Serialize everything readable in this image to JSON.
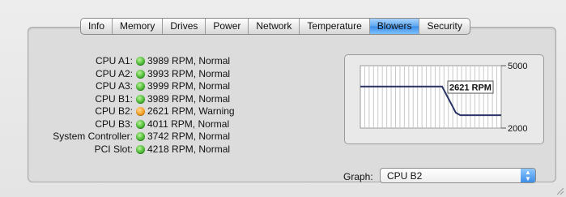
{
  "tabs": [
    {
      "label": "Info",
      "active": false
    },
    {
      "label": "Memory",
      "active": false
    },
    {
      "label": "Drives",
      "active": false
    },
    {
      "label": "Power",
      "active": false
    },
    {
      "label": "Network",
      "active": false
    },
    {
      "label": "Temperature",
      "active": false
    },
    {
      "label": "Blowers",
      "active": true
    },
    {
      "label": "Security",
      "active": false
    }
  ],
  "blowers": [
    {
      "label": "CPU A1:",
      "value": "3989 RPM, Normal",
      "status": "green"
    },
    {
      "label": "CPU A2:",
      "value": "3993 RPM, Normal",
      "status": "green"
    },
    {
      "label": "CPU A3:",
      "value": "3999 RPM, Normal",
      "status": "green"
    },
    {
      "label": "CPU B1:",
      "value": "3989 RPM, Normal",
      "status": "green"
    },
    {
      "label": "CPU B2:",
      "value": "2621 RPM, Warning",
      "status": "orange"
    },
    {
      "label": "CPU B3:",
      "value": "4011 RPM, Normal",
      "status": "green"
    },
    {
      "label": "System Controller:",
      "value": "3742 RPM, Normal",
      "status": "green"
    },
    {
      "label": "PCI Slot:",
      "value": "4218 RPM, Normal",
      "status": "green"
    }
  ],
  "graph": {
    "y_max_label": "5000",
    "y_min_label": "2000",
    "current_label": "2621 RPM",
    "y_range": [
      2000,
      5000
    ],
    "trace": [
      4000,
      4000,
      4000,
      4000,
      4000,
      4000,
      4000,
      4000,
      4000,
      4000,
      4000,
      4000,
      4000,
      4000,
      4000,
      4000,
      4000,
      4000,
      4000,
      3580,
      3160,
      2740,
      2621,
      2621,
      2621,
      2621,
      2621,
      2621,
      2621,
      2621,
      2621,
      2621
    ]
  },
  "graph_selector": {
    "label": "Graph:",
    "value": "CPU B2"
  },
  "colors": {
    "green": "#43b52c",
    "orange": "#f39a1b",
    "active_tab": "#3e8ee8",
    "trace": "#2a3566"
  }
}
